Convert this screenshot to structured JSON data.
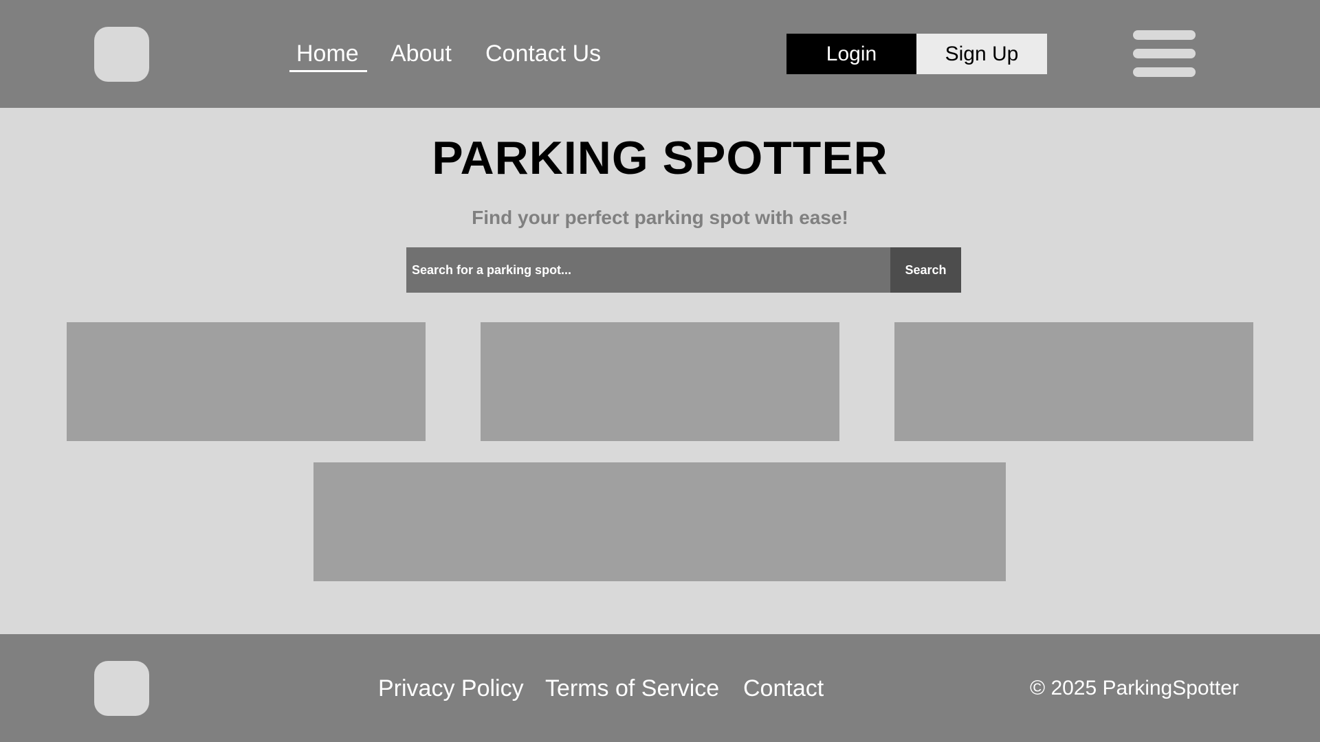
{
  "header": {
    "nav": {
      "home": "Home",
      "about": "About",
      "contact": "Contact Us"
    },
    "login_label": "Login",
    "signup_label": "Sign Up"
  },
  "hero": {
    "title": "PARKING SPOTTER",
    "subtitle": "Find your perfect parking spot with ease!"
  },
  "search": {
    "placeholder": "Search for a parking spot...",
    "button_label": "Search"
  },
  "footer": {
    "links": {
      "privacy": "Privacy Policy",
      "terms": "Terms of Service",
      "contact": "Contact"
    },
    "copyright": "© 2025 ParkingSpotter"
  },
  "colors": {
    "header_bg": "#808080",
    "page_bg": "#d9d9d9",
    "card_bg": "#a0a0a0",
    "login_bg": "#000000",
    "signup_bg": "#ebebeb",
    "search_input_bg": "#717171",
    "search_button_bg": "#4d4d4d"
  },
  "icons": {
    "menu": "hamburger-menu-icon",
    "logo": "logo-placeholder"
  }
}
